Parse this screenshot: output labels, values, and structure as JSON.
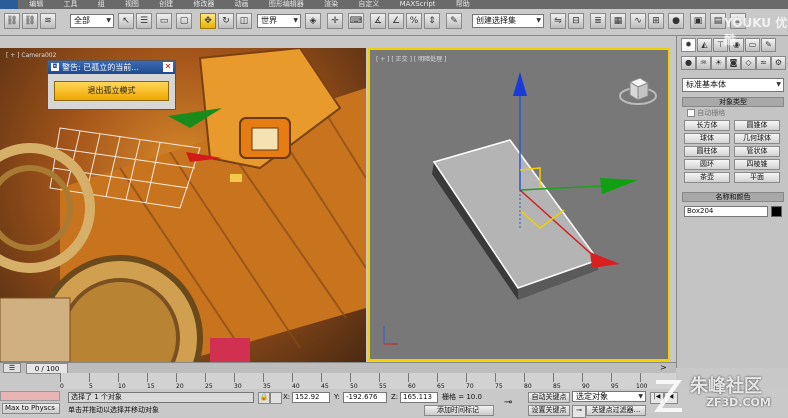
{
  "menu": {
    "items": [
      "编辑",
      "工具",
      "组",
      "视图",
      "创建",
      "修改器",
      "动画",
      "图形编辑器",
      "渲染",
      "自定义",
      "MAXScript",
      "帮助"
    ]
  },
  "toolbar": {
    "selection_filter": "全部",
    "reference_coord": "世界",
    "named_selection": "创建选择集"
  },
  "viewports": {
    "left_label": "[ + ] Camera002",
    "right_label": "[ + ] [ 正交 ] [ 明暗处理 ]"
  },
  "warning_floater": {
    "title": "警告: 已孤立的当前...",
    "exit_button": "退出孤立模式"
  },
  "command_panel": {
    "category_dropdown": "标准基本体",
    "object_type_header": "对象类型",
    "autogrid_label": "自动栅格",
    "object_buttons": [
      "长方体",
      "圆锥体",
      "球体",
      "几何球体",
      "圆柱体",
      "管状体",
      "圆环",
      "四棱锥",
      "茶壶",
      "平面"
    ],
    "name_color_header": "名称和颜色",
    "object_name": "Box204",
    "object_color": "#000000"
  },
  "timeline": {
    "frame_counter": "0 / 100",
    "ticks": [
      "0",
      "5",
      "10",
      "15",
      "20",
      "25",
      "30",
      "35",
      "40",
      "45",
      "50",
      "55",
      "60",
      "65",
      "70",
      "75",
      "80",
      "85",
      "90",
      "95",
      "100"
    ]
  },
  "status": {
    "physics_button": "Max to Physcs",
    "selection_info": "选择了 1 个对象",
    "prompt": "单击并拖动以选择并移动对象",
    "x_label": "X:",
    "x_value": "152.92",
    "y_label": "Y:",
    "y_value": "-192.676",
    "z_label": "Z:",
    "z_value": "165.113",
    "grid": "栅格 = 10.0",
    "add_time_tag": "添加时间标记",
    "auto_key": "自动关键点",
    "set_key": "设置关键点",
    "key_mode": "选定对象",
    "key_filters": "关键点过滤器..."
  },
  "watermarks": {
    "top_right": "YOUKU 优酷",
    "bottom_right_brand": "朱峰社区",
    "bottom_right_url": "ZF3D.COM"
  }
}
